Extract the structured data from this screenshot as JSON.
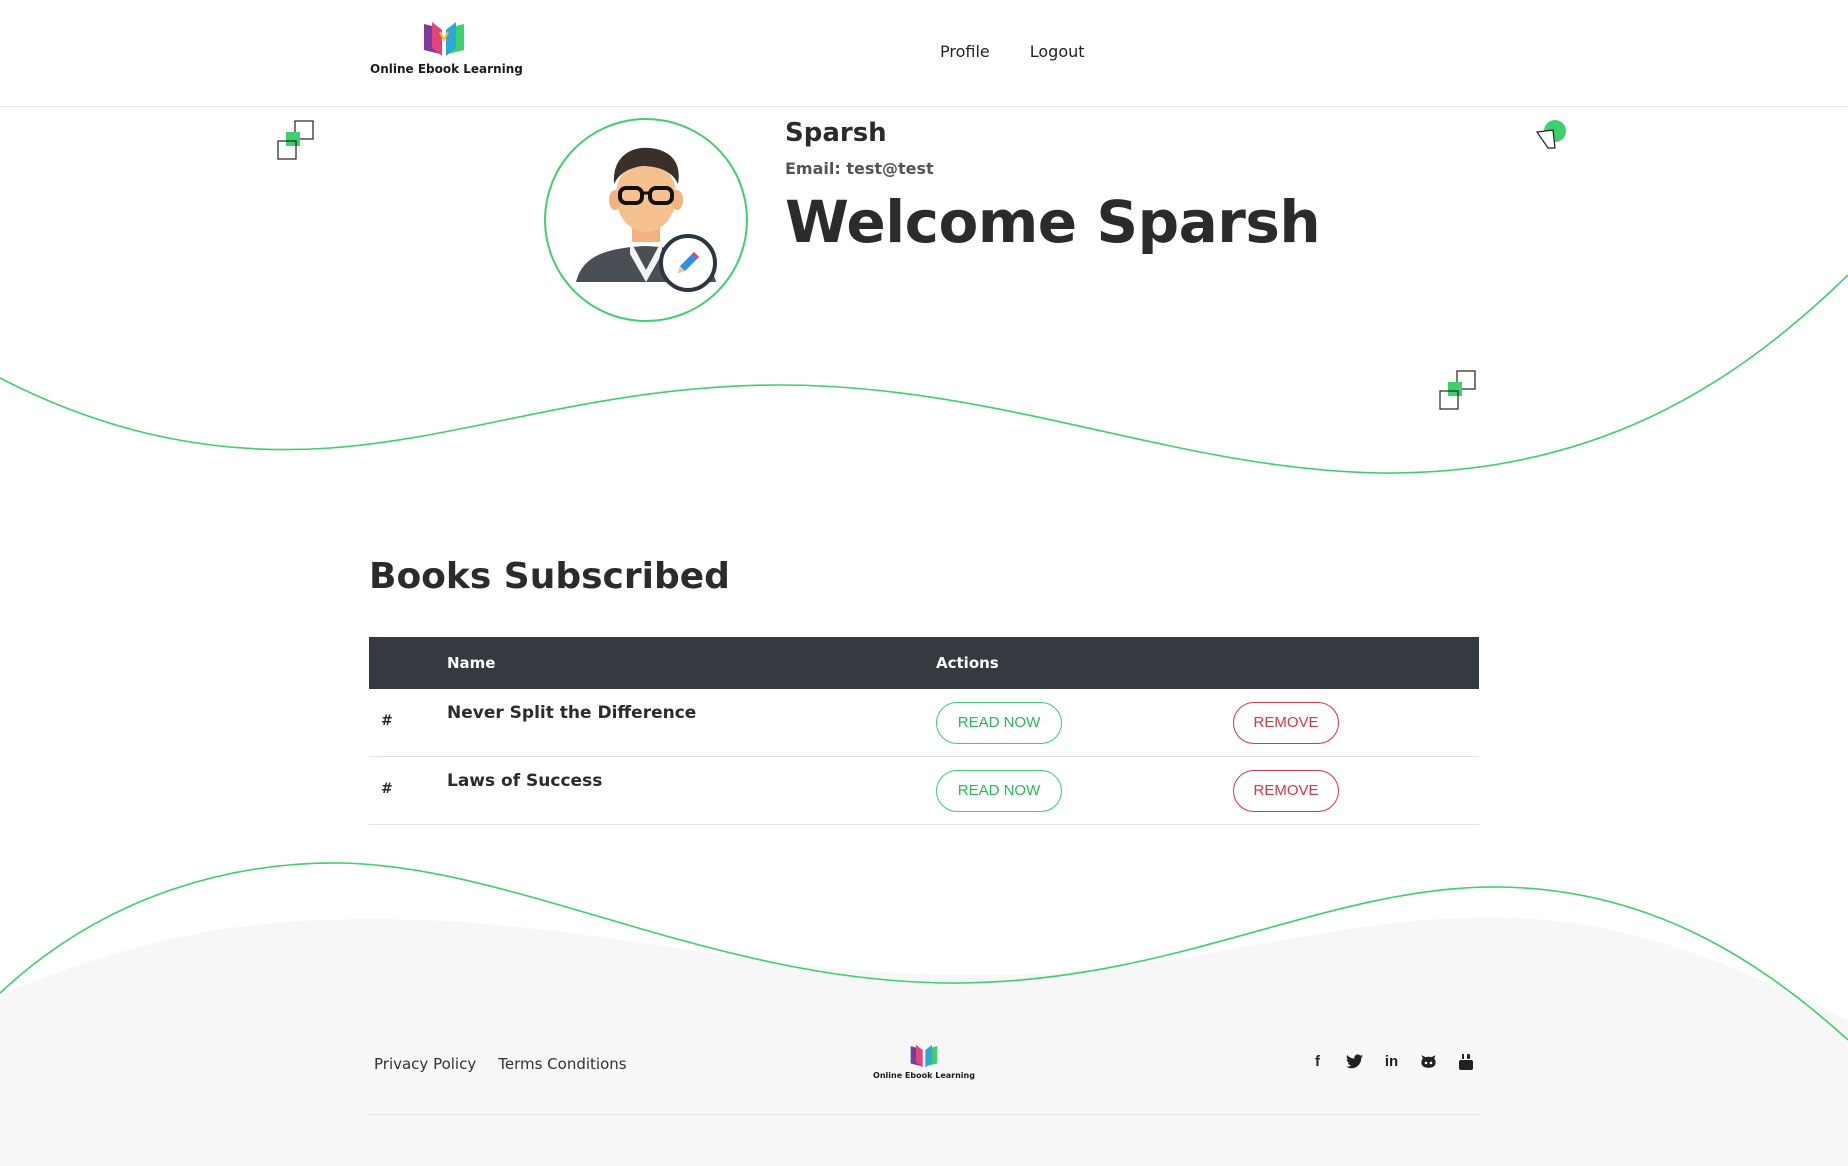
{
  "brand": {
    "name": "Online Ebook Learning"
  },
  "nav": {
    "profile": "Profile",
    "logout": "Logout"
  },
  "user": {
    "name": "Sparsh",
    "email_label": "Email:",
    "email": "test@test",
    "welcome": "Welcome Sparsh"
  },
  "books": {
    "title": "Books Subscribed",
    "columns": {
      "index": "",
      "name": "Name",
      "actions": "Actions"
    },
    "rows": [
      {
        "index": "#",
        "name": "Never Split the Difference",
        "read": "READ NOW",
        "remove": "REMOVE"
      },
      {
        "index": "#",
        "name": "Laws of Success",
        "read": "READ NOW",
        "remove": "REMOVE"
      }
    ]
  },
  "footer": {
    "privacy": "Privacy Policy",
    "terms": "Terms Conditions",
    "social_icons": [
      "facebook-icon",
      "twitter-icon",
      "linkedin-icon",
      "github-icon",
      "youtube-icon"
    ],
    "social_glyphs": {
      "facebook": "f",
      "linkedin": "in"
    }
  },
  "colors": {
    "accent": "#3ecf6e",
    "danger": "#dc3545",
    "table_head": "#343a40",
    "footer_bg": "#f7f7f7"
  }
}
